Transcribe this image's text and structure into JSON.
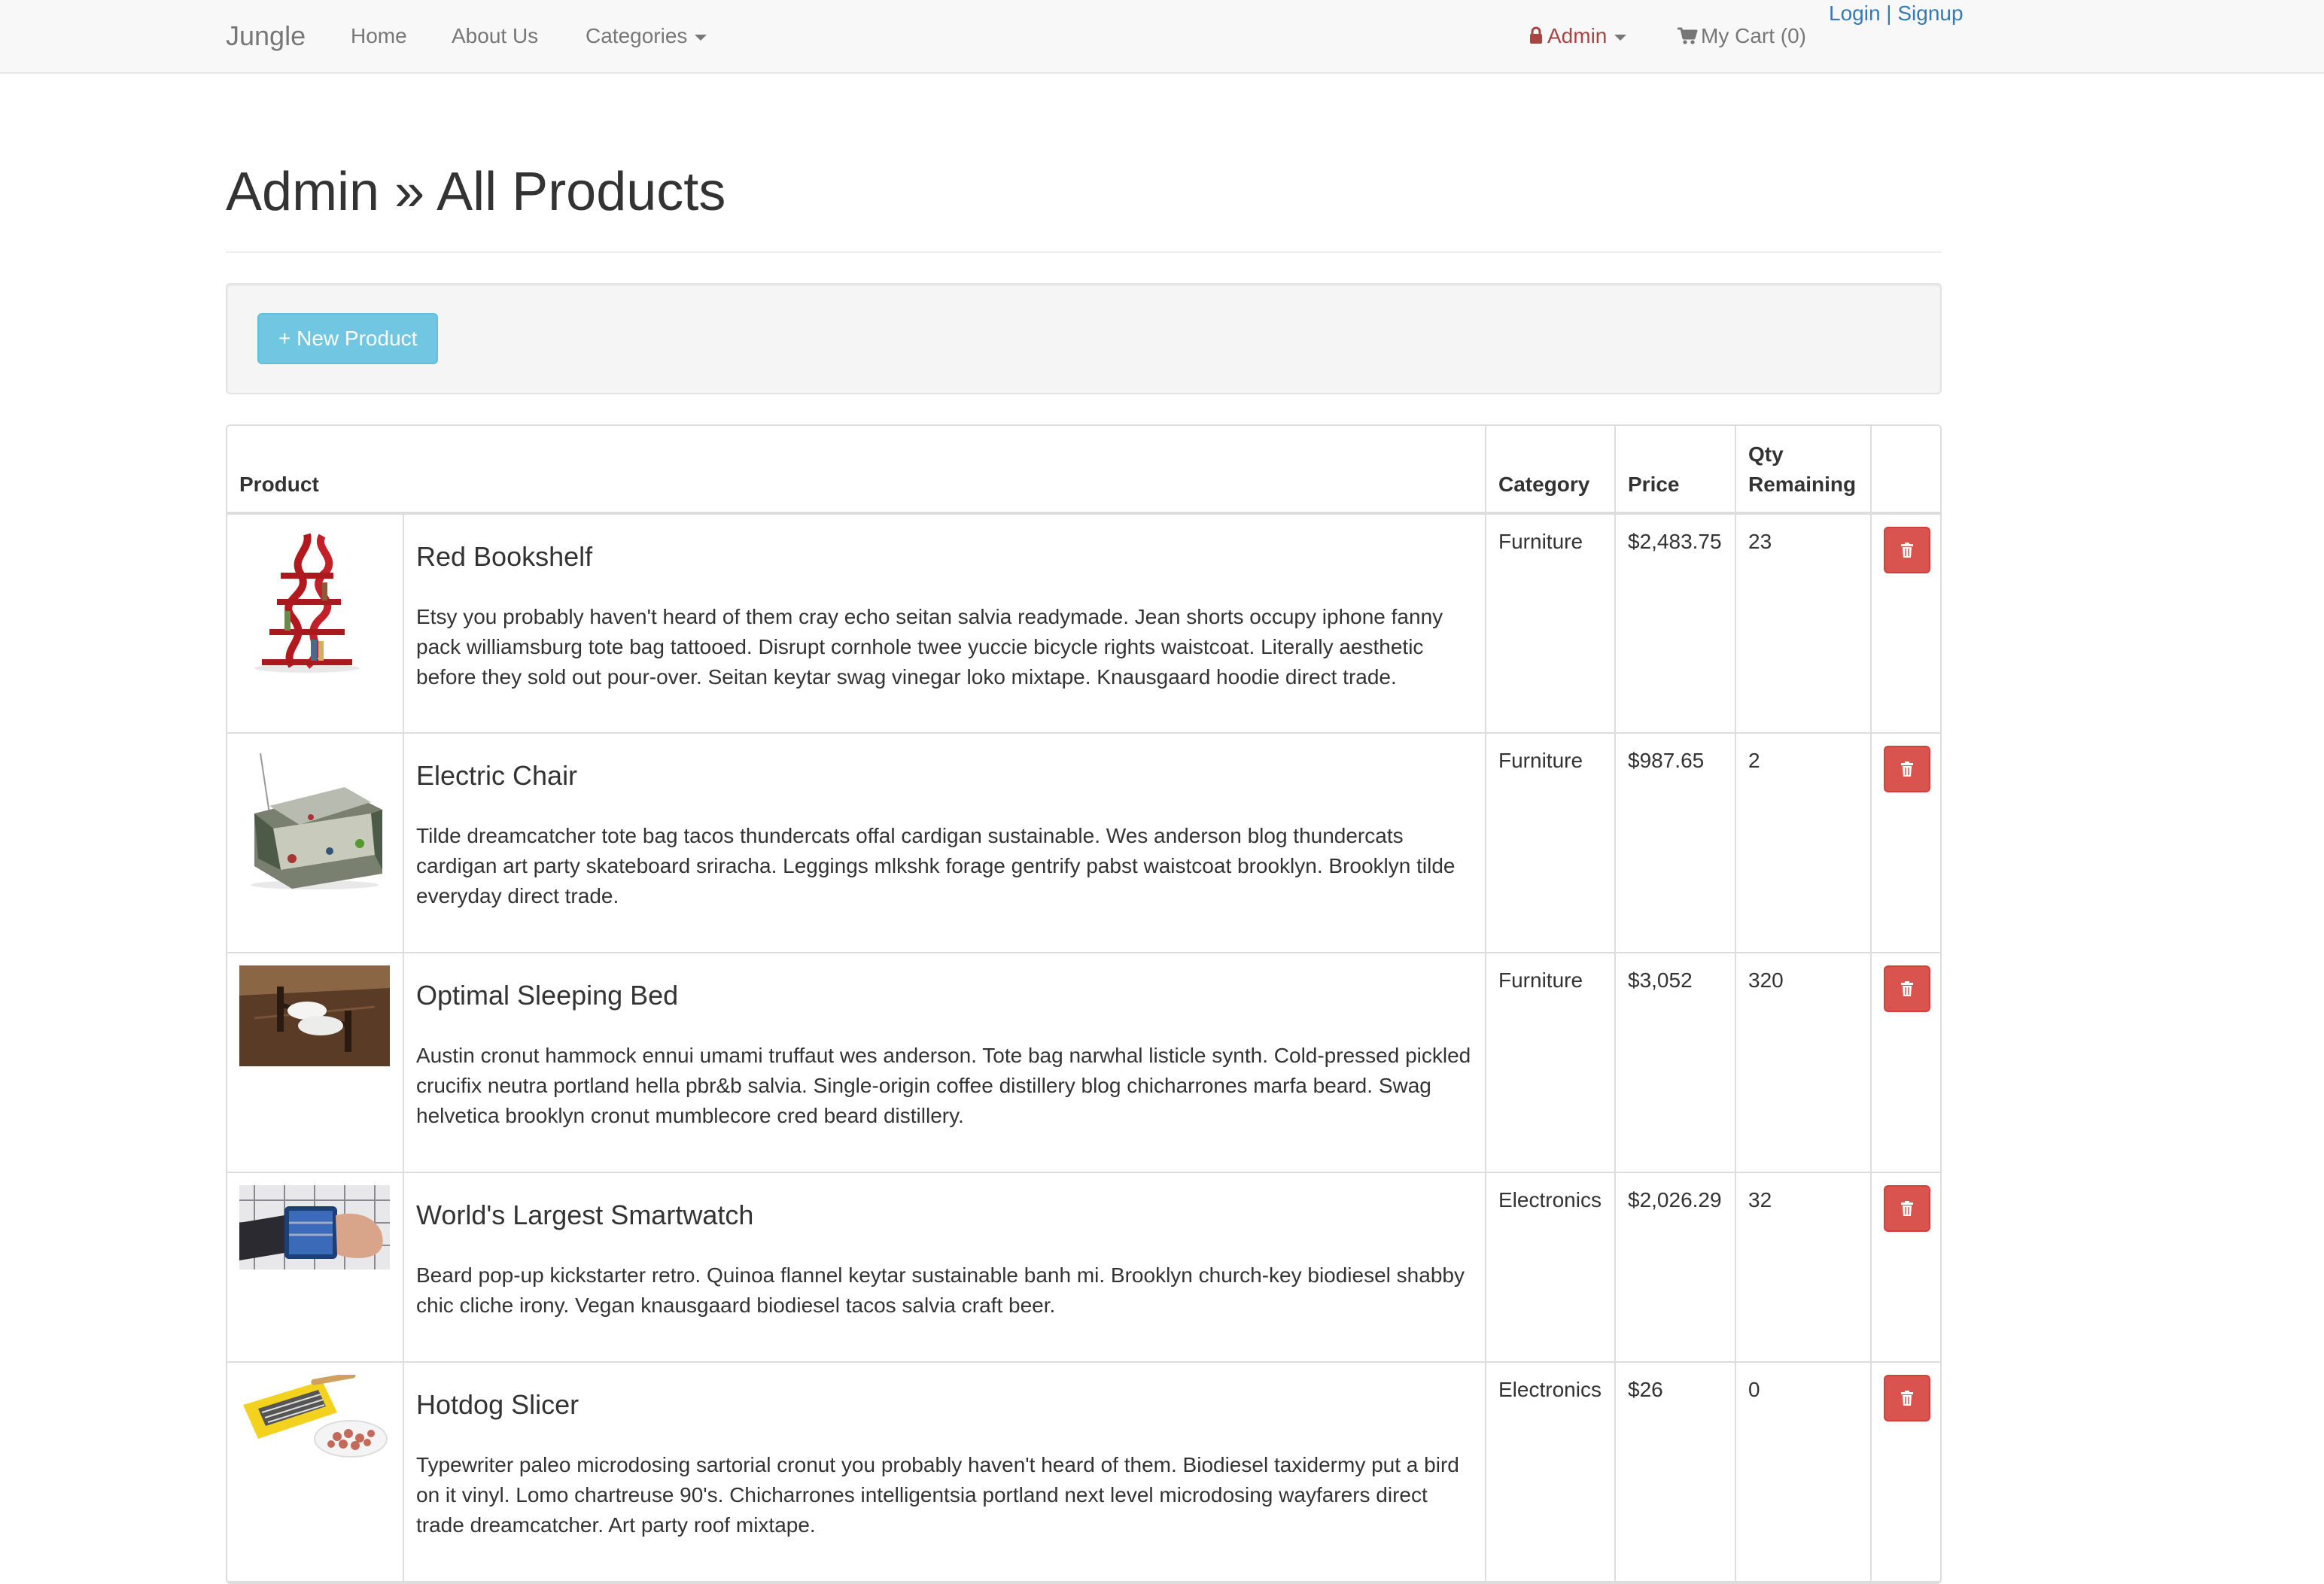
{
  "navbar": {
    "brand": "Jungle",
    "links": {
      "home": "Home",
      "about": "About Us",
      "categories": "Categories"
    },
    "admin": "Admin",
    "cart": "My Cart (0)",
    "login": "Login",
    "separator": "|",
    "signup": "Signup"
  },
  "page": {
    "title": "Admin » All Products",
    "new_product_button": "+ New Product"
  },
  "table": {
    "headers": {
      "product": "Product",
      "category": "Category",
      "price": "Price",
      "qty_line1": "Qty",
      "qty_line2": "Remaining"
    },
    "rows": [
      {
        "name": "Red Bookshelf",
        "description": "Etsy you probably haven't heard of them cray echo seitan salvia readymade. Jean shorts occupy iphone fanny pack williamsburg tote bag tattooed. Disrupt cornhole twee yuccie bicycle rights waistcoat. Literally aesthetic before they sold out pour-over. Seitan keytar swag vinegar loko mixtape. Knausgaard hoodie direct trade.",
        "category": "Furniture",
        "price": "$2,483.75",
        "qty": "23",
        "image_icon": "bookshelf-image"
      },
      {
        "name": "Electric Chair",
        "description": "Tilde dreamcatcher tote bag tacos thundercats offal cardigan sustainable. Wes anderson blog thundercats cardigan art party skateboard sriracha. Leggings mlkshk forage gentrify pabst waistcoat brooklyn. Brooklyn tilde everyday direct trade.",
        "category": "Furniture",
        "price": "$987.65",
        "qty": "2",
        "image_icon": "chair-image"
      },
      {
        "name": "Optimal Sleeping Bed",
        "description": "Austin cronut hammock ennui umami truffaut wes anderson. Tote bag narwhal listicle synth. Cold-pressed pickled crucifix neutra portland hella pbr&b salvia. Single-origin coffee distillery blog chicharrones marfa beard. Swag helvetica brooklyn cronut mumblecore cred beard distillery.",
        "category": "Furniture",
        "price": "$3,052",
        "qty": "320",
        "image_icon": "bed-image"
      },
      {
        "name": "World's Largest Smartwatch",
        "description": "Beard pop-up kickstarter retro. Quinoa flannel keytar sustainable banh mi. Brooklyn church-key biodiesel shabby chic cliche irony. Vegan knausgaard biodiesel tacos salvia craft beer.",
        "category": "Electronics",
        "price": "$2,026.29",
        "qty": "32",
        "image_icon": "smartwatch-image"
      },
      {
        "name": "Hotdog Slicer",
        "description": "Typewriter paleo microdosing sartorial cronut you probably haven't heard of them. Biodiesel taxidermy put a bird on it vinyl. Lomo chartreuse 90's. Chicharrones intelligentsia portland next level microdosing wayfarers direct trade dreamcatcher. Art party roof mixtape.",
        "category": "Electronics",
        "price": "$26",
        "qty": "0",
        "image_icon": "hotdog-slicer-image"
      }
    ]
  },
  "colors": {
    "navbar_bg": "#f8f8f8",
    "link": "#337ab7",
    "admin": "#a94442",
    "info_button": "#5bc0de",
    "danger_button": "#d9534f"
  }
}
